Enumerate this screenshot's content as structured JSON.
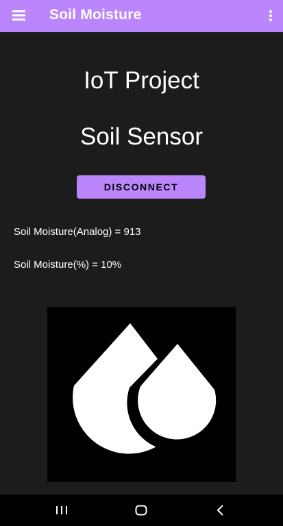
{
  "appbar": {
    "title": "Soil Moisture",
    "menu_icon": "hamburger-menu-icon",
    "overflow_icon": "overflow-menu-icon",
    "color": "#bb86fc"
  },
  "main": {
    "heading1": "IoT Project",
    "heading2": "Soil Sensor",
    "disconnect_label": "DISCONNECT",
    "reading_analog": "Soil Moisture(Analog) = 913",
    "reading_percent": "Soil Moisture(%) = 10%",
    "image_icon": "water-drops-icon"
  },
  "navbar": {
    "recent_icon": "recent-apps-icon",
    "home_icon": "home-icon",
    "back_icon": "back-icon"
  },
  "colors": {
    "accent": "#bb86fc",
    "background": "#1c1c1c"
  }
}
